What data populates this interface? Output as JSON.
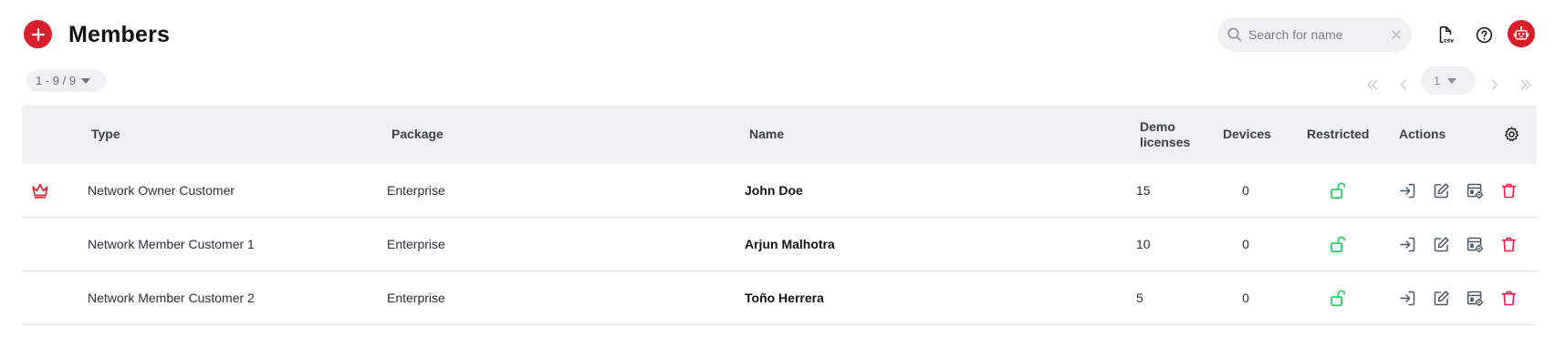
{
  "header": {
    "title": "Members",
    "add_icon": "plus-icon",
    "search_placeholder": "Search for name",
    "search_value": "",
    "csv_icon": "csv-export-icon",
    "help_icon": "help-circle-icon",
    "avatar_icon": "robot-avatar-icon"
  },
  "pagination": {
    "range_label": "1 - 9 / 9",
    "current_page": "1",
    "first_icon": "double-chevron-left-icon",
    "prev_icon": "chevron-left-icon",
    "next_icon": "chevron-right-icon",
    "last_icon": "double-chevron-right-icon"
  },
  "table": {
    "columns": {
      "type": "Type",
      "package": "Package",
      "name": "Name",
      "demo_licenses": "Demo licenses",
      "devices": "Devices",
      "restricted": "Restricted",
      "actions": "Actions"
    },
    "settings_icon": "gear-icon",
    "rows": [
      {
        "is_owner": true,
        "type": "Network Owner Customer",
        "package": "Enterprise",
        "name": "John Doe",
        "demo_licenses": "15",
        "devices": "0",
        "restricted": "unlocked"
      },
      {
        "is_owner": false,
        "type": "Network Member Customer 1",
        "package": "Enterprise",
        "name": "Arjun Malhotra",
        "demo_licenses": "10",
        "devices": "0",
        "restricted": "unlocked"
      },
      {
        "is_owner": false,
        "type": "Network Member Customer 2",
        "package": "Enterprise",
        "name": "Toño Herrera",
        "demo_licenses": "5",
        "devices": "0",
        "restricted": "unlocked"
      }
    ],
    "action_icons": [
      "login-icon",
      "edit-icon",
      "manage-settings-icon",
      "trash-icon"
    ]
  },
  "colors": {
    "brand_red": "#d81e2a",
    "unlock_green": "#22c55e",
    "delete_red": "#e11d48",
    "action_gray": "#4b5563",
    "header_bg": "#eef0f2"
  }
}
